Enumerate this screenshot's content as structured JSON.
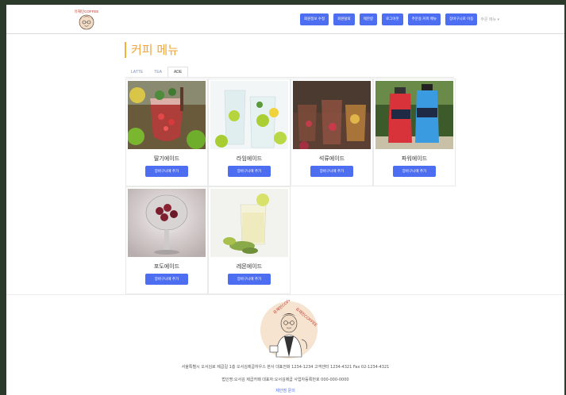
{
  "header": {
    "logo_text": "유재민COFFEE",
    "nav": [
      {
        "label": "회원정보 수정"
      },
      {
        "label": "회원탈퇴"
      },
      {
        "label": "제한량"
      },
      {
        "label": "로그아웃"
      },
      {
        "label": "주문용 커피 메뉴"
      },
      {
        "label": "장바구니로 이동"
      }
    ],
    "dropdown_label": "주문 메뉴 ▾"
  },
  "page_title": "커피 메뉴",
  "tabs": [
    {
      "label": "LATTE"
    },
    {
      "label": "TEA"
    },
    {
      "label": "ADE"
    }
  ],
  "products": [
    {
      "name": "딸기에이드",
      "button": "장바구니에 추가"
    },
    {
      "name": "라임에이드",
      "button": "장바구니에 추가"
    },
    {
      "name": "석류에이드",
      "button": "장바구니에 추가"
    },
    {
      "name": "파워에이드",
      "button": "장바구니에 추가"
    },
    {
      "name": "포도에이드",
      "button": "장바구니에 추가"
    },
    {
      "name": "레몬에이드",
      "button": "장바구니에 추가"
    }
  ],
  "footer": {
    "logo_text": "유재민COFFEE",
    "address": "서울특별시 오서김로 제곱길 1층 오서김제곱하우스 본사 대표전화 1234-1234 고객센터 1234-4321 Fax 02-1234-4321",
    "company": "법인명:오서김 제곱카페 대표자:오서김제곱 사업자등록번호 000-000-0000",
    "link": "제안점 문의"
  },
  "colors": {
    "accent": "#4e6ef2",
    "title": "#f0a63a",
    "background_outer": "#2c3a2b"
  }
}
